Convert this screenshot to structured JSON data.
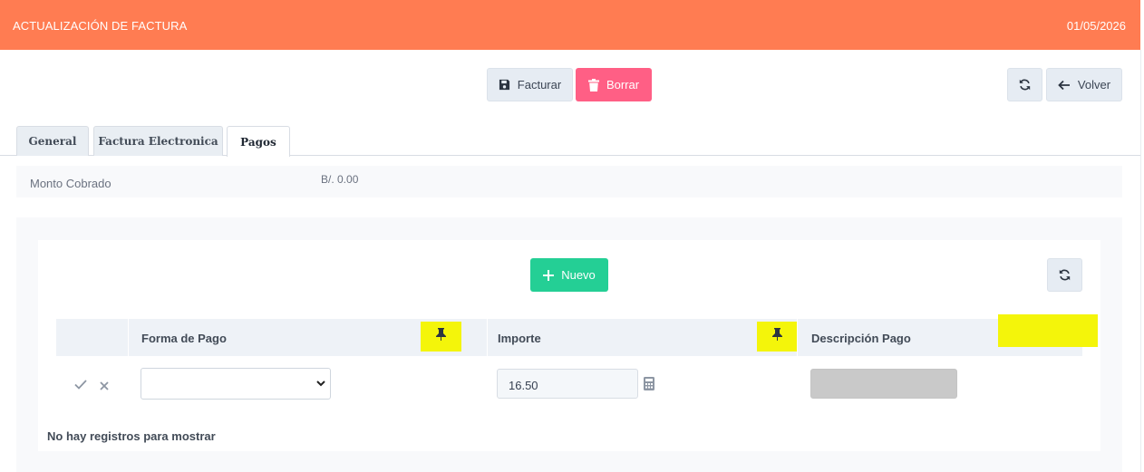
{
  "header": {
    "title": "ACTUALIZACIÓN DE FACTURA",
    "date": "01/05/2026",
    "color": "#ff7c52"
  },
  "toolbar": {
    "facturar_label": "Facturar",
    "borrar_label": "Borrar",
    "volver_label": "Volver",
    "icons": [
      "save-icon",
      "trash-icon",
      "refresh-icon",
      "arrow-left-icon"
    ]
  },
  "tabs": [
    {
      "label": "General",
      "active": false
    },
    {
      "label": "Factura Electronica",
      "active": false
    },
    {
      "label": "Pagos",
      "active": true
    }
  ],
  "summary": {
    "label": "Monto Cobrado",
    "value": "B/. 0.00"
  },
  "grid": {
    "new_label": "Nuevo",
    "columns": [
      "Forma de Pago",
      "Importe",
      "Descripción Pago"
    ],
    "edit_row": {
      "forma_de_pago": "",
      "importe": "16.50",
      "descripcion": ""
    },
    "empty_message": "No hay registros para mostrar"
  },
  "colors": {
    "danger": "#ff5f85",
    "success": "#24cf95",
    "highlight": "#f4f50a"
  }
}
